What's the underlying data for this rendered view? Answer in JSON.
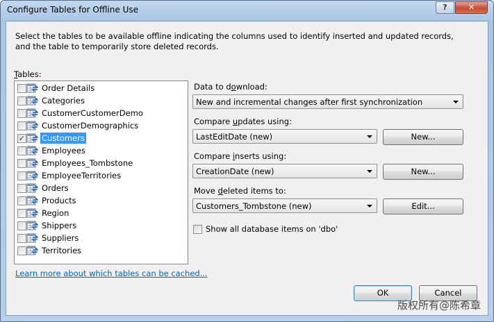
{
  "window": {
    "title": "Configure Tables for Offline Use",
    "help_label": "?",
    "close_label": "✕"
  },
  "description": "Select the tables to be available offline indicating the columns used to identify inserted and updated records, and the table to temporarily store deleted records.",
  "tables": {
    "label": "Tables:",
    "items": [
      {
        "name": "Order Details",
        "checked": false,
        "selected": false
      },
      {
        "name": "Categories",
        "checked": false,
        "selected": false
      },
      {
        "name": "CustomerCustomerDemo",
        "checked": false,
        "selected": false
      },
      {
        "name": "CustomerDemographics",
        "checked": false,
        "selected": false
      },
      {
        "name": "Customers",
        "checked": true,
        "selected": true
      },
      {
        "name": "Employees",
        "checked": false,
        "selected": false
      },
      {
        "name": "Employees_Tombstone",
        "checked": false,
        "selected": false
      },
      {
        "name": "EmployeeTerritories",
        "checked": false,
        "selected": false
      },
      {
        "name": "Orders",
        "checked": false,
        "selected": false
      },
      {
        "name": "Products",
        "checked": false,
        "selected": false
      },
      {
        "name": "Region",
        "checked": false,
        "selected": false
      },
      {
        "name": "Shippers",
        "checked": false,
        "selected": false
      },
      {
        "name": "Suppliers",
        "checked": false,
        "selected": false
      },
      {
        "name": "Territories",
        "checked": false,
        "selected": false
      }
    ]
  },
  "learn_more_link": "Learn more about which tables can be cached...",
  "data_to_download": {
    "label": "Data to download:",
    "value": "New and incremental changes after first synchronization"
  },
  "compare_updates": {
    "label": "Compare updates using:",
    "value": "LastEditDate (new)",
    "button": "New..."
  },
  "compare_inserts": {
    "label": "Compare inserts using:",
    "value": "CreationDate (new)",
    "button": "New..."
  },
  "move_deleted": {
    "label": "Move deleted items to:",
    "value": "Customers_Tombstone (new)",
    "button": "Edit..."
  },
  "show_all": {
    "label": "Show all database items on 'dbo'",
    "checked": false
  },
  "buttons": {
    "ok": "OK",
    "cancel": "Cancel"
  },
  "watermark": "版权所有@陈希章",
  "colors": {
    "selection": "#3399ff",
    "link": "#0066cc",
    "client_bg": "#f0f0f0"
  }
}
